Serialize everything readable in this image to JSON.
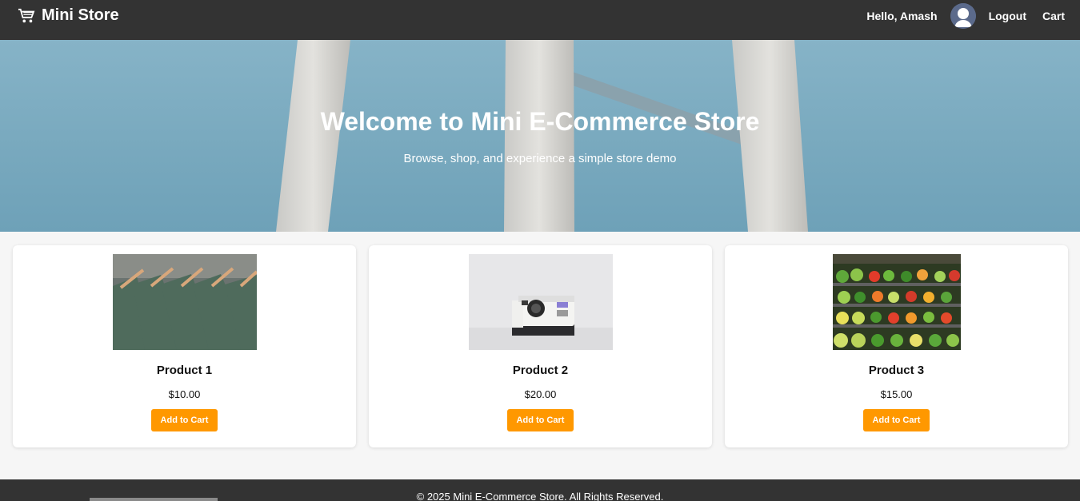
{
  "navbar": {
    "brand_icon": "shopping-cart-icon",
    "brand": "Mini Store",
    "greeting": "Hello, Amash",
    "avatar_icon": "user-avatar-icon",
    "logout": "Logout",
    "cart": "Cart",
    "background": "#333333"
  },
  "hero": {
    "title": "Welcome to Mini E-Commerce Store",
    "subtitle": "Browse, shop, and experience a simple store demo"
  },
  "products": [
    {
      "name": "Product 1",
      "price": "$10.00",
      "button": "Add to Cart",
      "image": "shirts-on-hangers-image"
    },
    {
      "name": "Product 2",
      "price": "$20.00",
      "button": "Add to Cart",
      "image": "instant-camera-image"
    },
    {
      "name": "Product 3",
      "price": "$15.00",
      "button": "Add to Cart",
      "image": "vegetable-shelves-image"
    }
  ],
  "footer": {
    "text": "© 2025 Mini E-Commerce Store. All Rights Reserved."
  },
  "colors": {
    "accent": "#ff9800",
    "dark": "#333333"
  }
}
